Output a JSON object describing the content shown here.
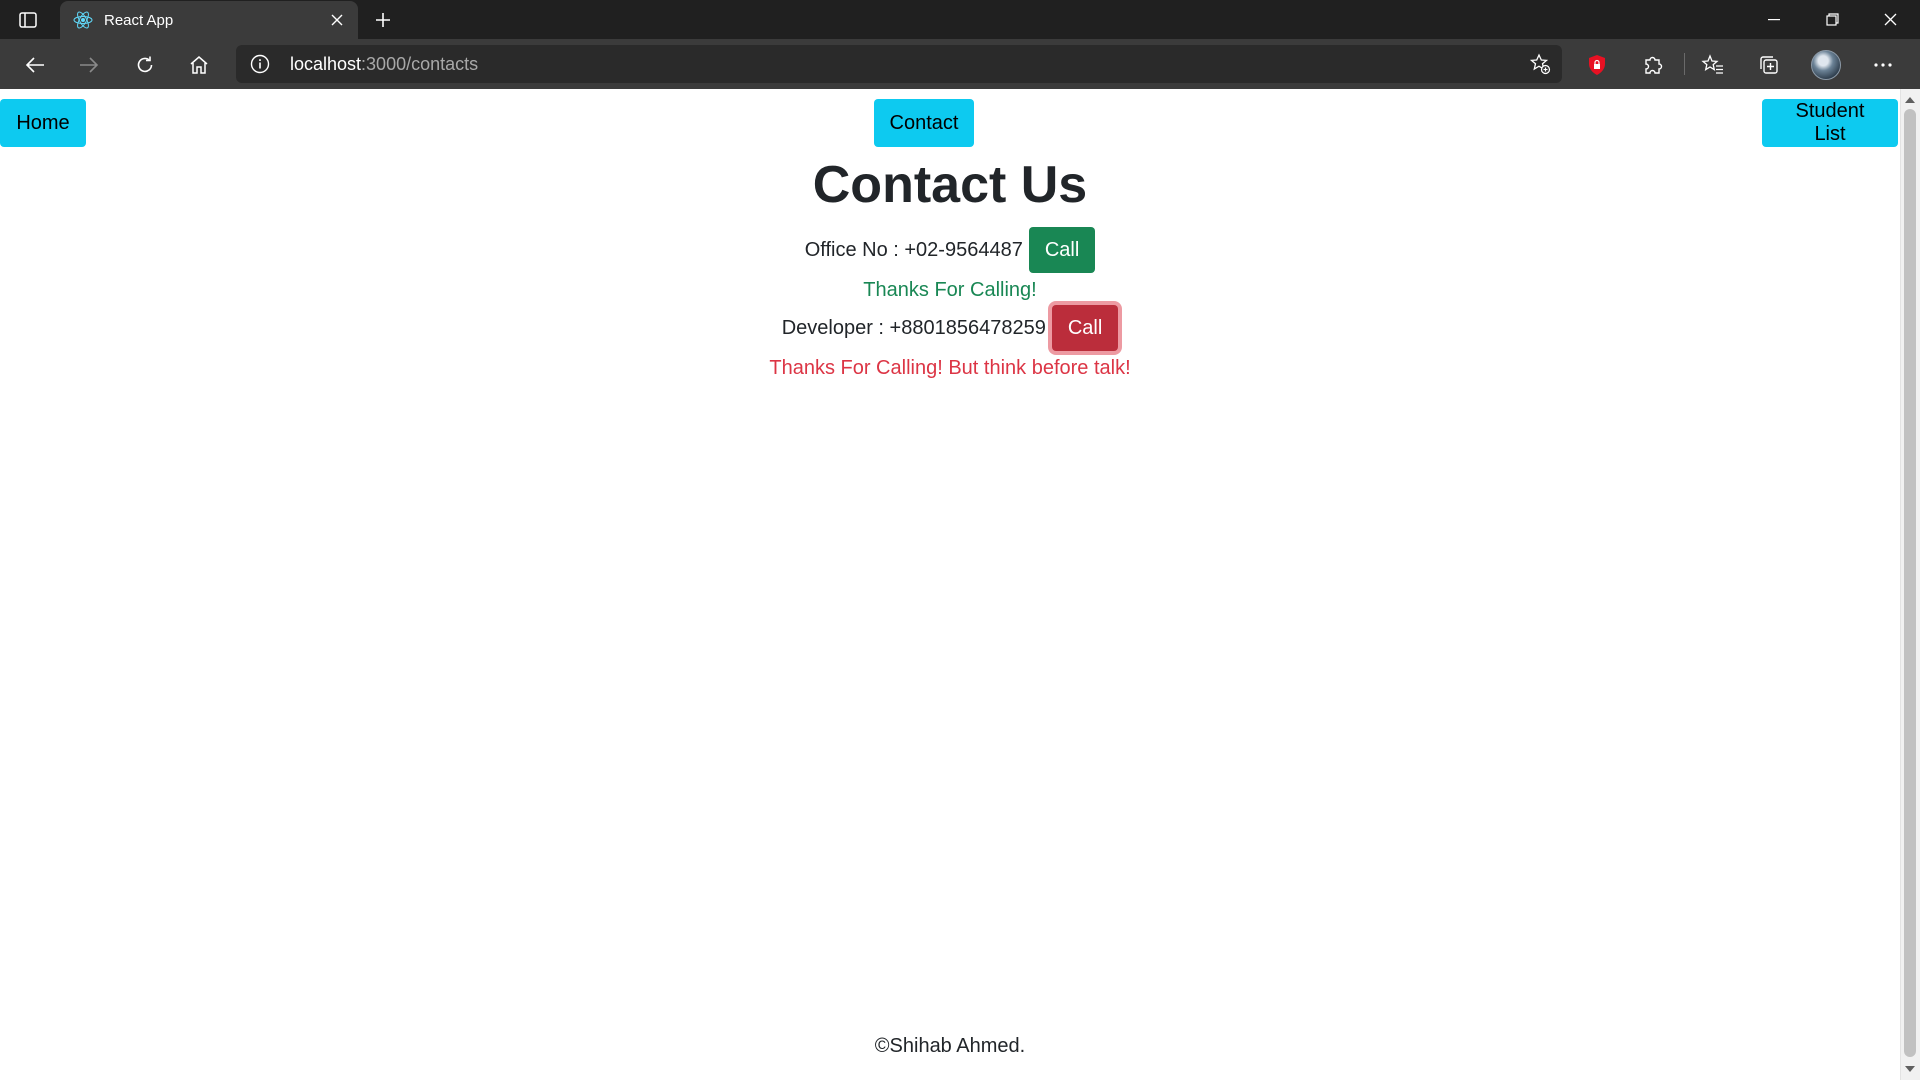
{
  "browser": {
    "tab_title": "React App",
    "url_host": "localhost",
    "url_rest": ":3000/contacts"
  },
  "nav": {
    "home_label": "Home",
    "contact_label": "Contact",
    "student_list_label": "Student List",
    "button_color": "#0dcaf0"
  },
  "main": {
    "title": "Contact Us",
    "office": {
      "label": "Office No : +02-9564487",
      "call_label": "Call",
      "message": "Thanks For Calling!",
      "color": "#198754"
    },
    "developer": {
      "label": "Developer : +8801856478259",
      "call_label": "Call",
      "message": "Thanks For Calling! But think before talk!",
      "color": "#dc3545"
    }
  },
  "footer": {
    "text": "©Shihab Ahmed."
  }
}
